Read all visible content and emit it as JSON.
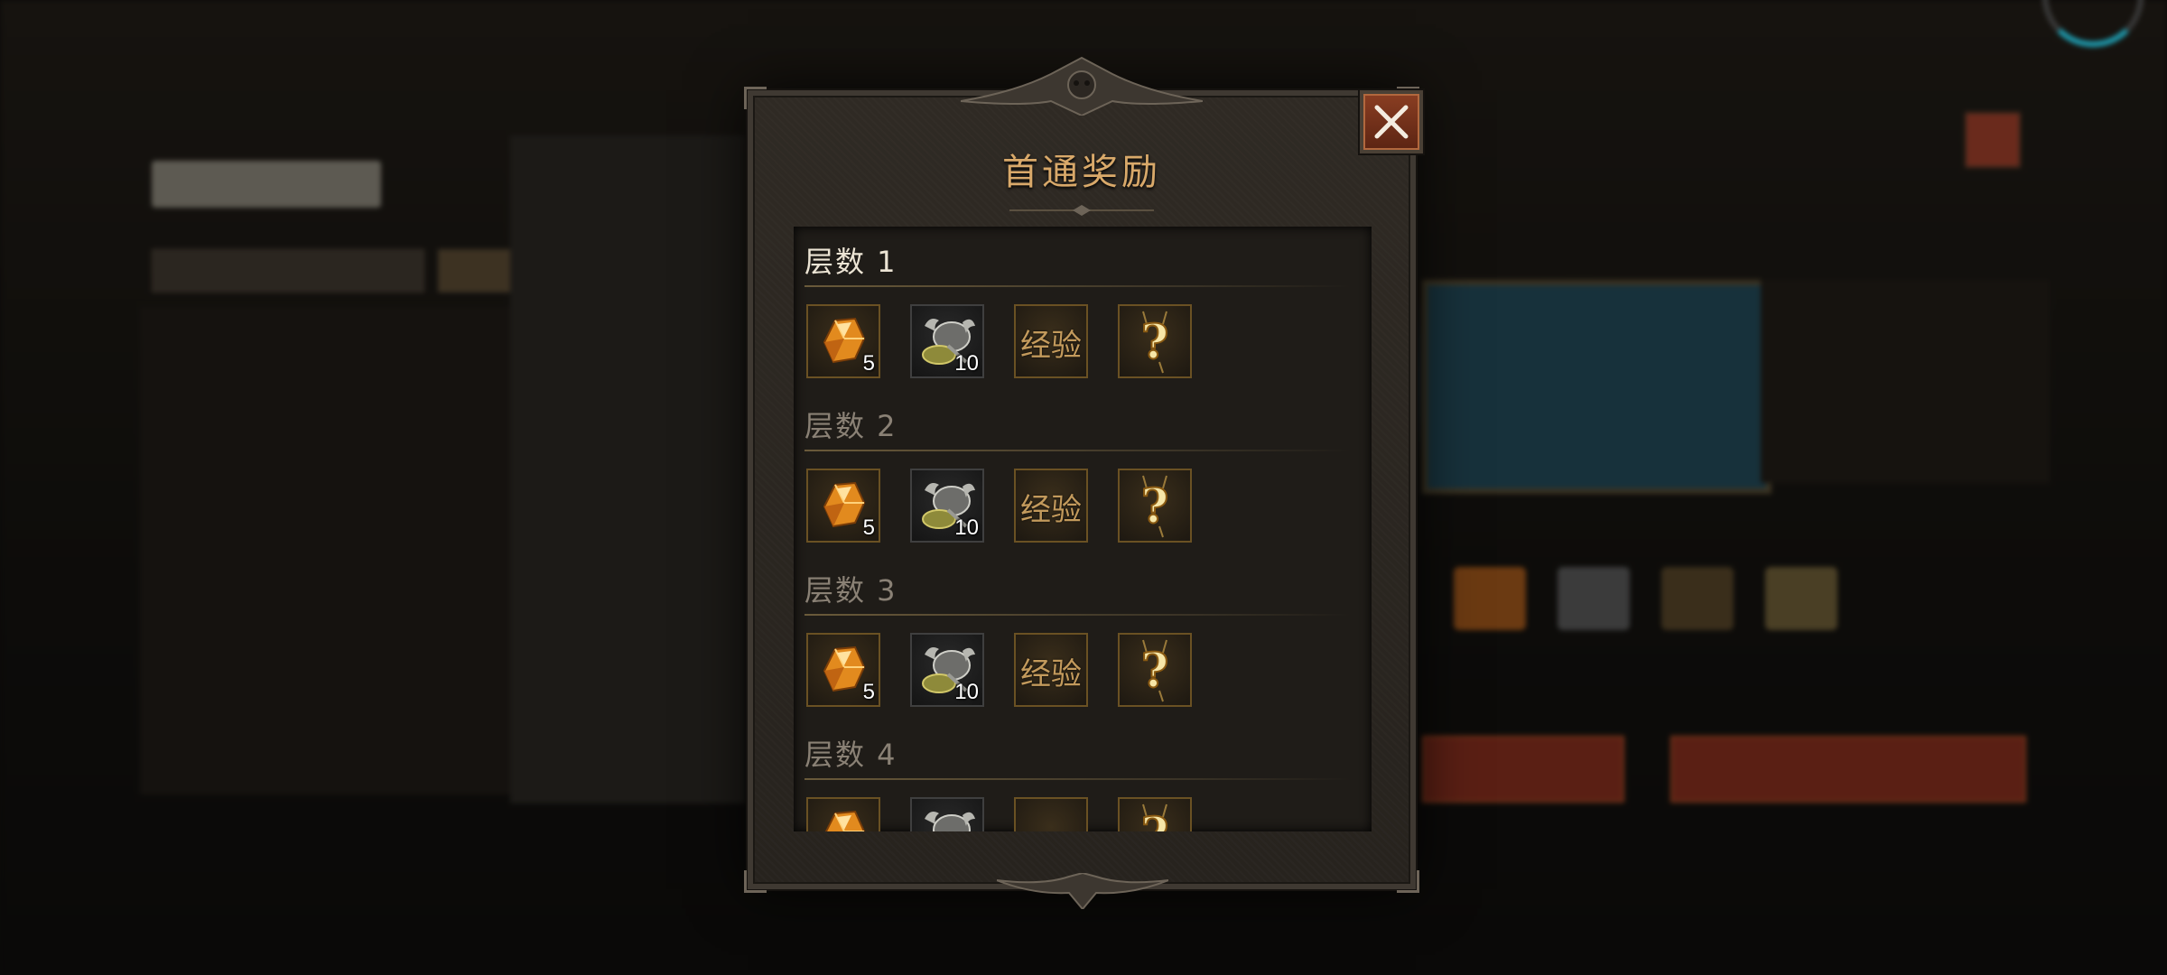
{
  "dialog": {
    "title": "首通奖励",
    "close_icon": "close-x-icon"
  },
  "floors": [
    {
      "label": "层数 1",
      "active": true,
      "rewards": [
        {
          "icon": "amber-crystal-icon",
          "count": "5"
        },
        {
          "icon": "horned-helmet-gear-icon",
          "count": "10"
        },
        {
          "icon": "experience-icon",
          "text": "经验"
        },
        {
          "icon": "mystery-question-icon"
        }
      ]
    },
    {
      "label": "层数 2",
      "active": false,
      "rewards": [
        {
          "icon": "amber-crystal-icon",
          "count": "5"
        },
        {
          "icon": "horned-helmet-gear-icon",
          "count": "10"
        },
        {
          "icon": "experience-icon",
          "text": "经验"
        },
        {
          "icon": "mystery-question-icon"
        }
      ]
    },
    {
      "label": "层数 3",
      "active": false,
      "rewards": [
        {
          "icon": "amber-crystal-icon",
          "count": "5"
        },
        {
          "icon": "horned-helmet-gear-icon",
          "count": "10"
        },
        {
          "icon": "experience-icon",
          "text": "经验"
        },
        {
          "icon": "mystery-question-icon"
        }
      ]
    },
    {
      "label": "层数 4",
      "active": false,
      "rewards": [
        {
          "icon": "amber-crystal-icon"
        },
        {
          "icon": "horned-helmet-gear-icon"
        },
        {
          "icon": "experience-icon"
        },
        {
          "icon": "mystery-question-icon"
        }
      ]
    }
  ],
  "colors": {
    "title": "#d9a96a",
    "active_label": "#ece4d4",
    "inactive_label": "#8a8175",
    "close_button": "#8a3e22"
  }
}
